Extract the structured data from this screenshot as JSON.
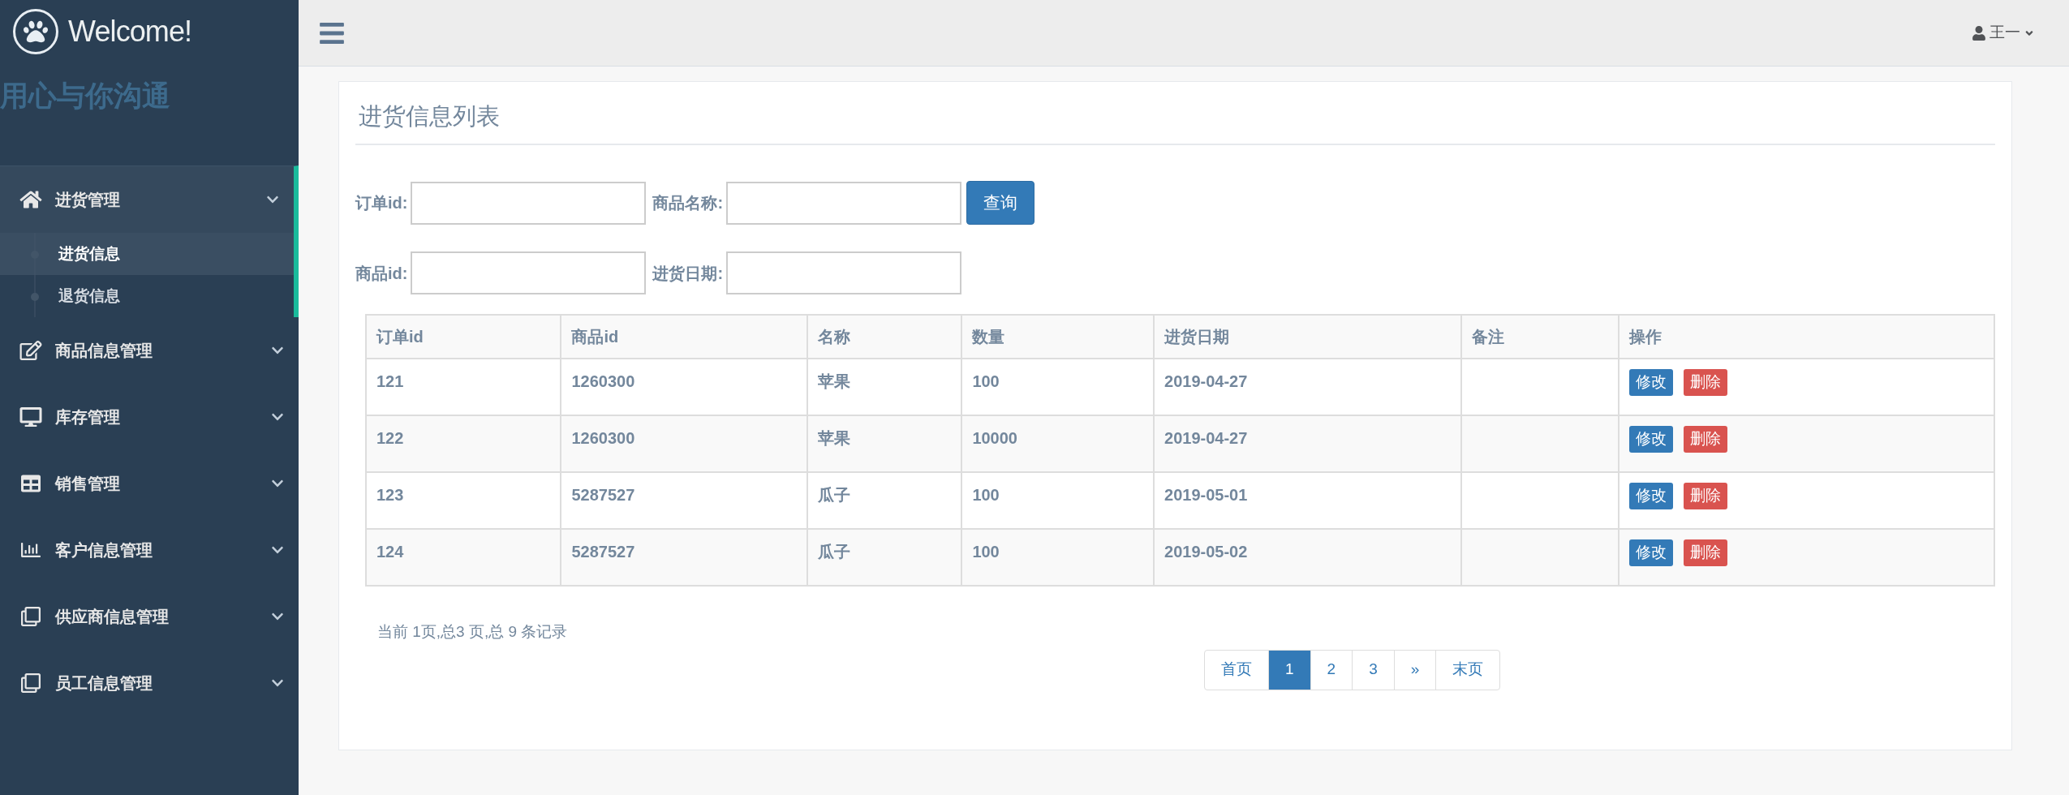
{
  "sidebar": {
    "brand": "Welcome!",
    "slogan": "用心与你沟通",
    "menu": [
      {
        "label": "进货管理",
        "expanded": true,
        "children": [
          {
            "label": "进货信息",
            "selected": true
          },
          {
            "label": "退货信息",
            "selected": false
          }
        ]
      },
      {
        "label": "商品信息管理",
        "expanded": false
      },
      {
        "label": "库存管理",
        "expanded": false
      },
      {
        "label": "销售管理",
        "expanded": false
      },
      {
        "label": "客户信息管理",
        "expanded": false
      },
      {
        "label": "供应商信息管理",
        "expanded": false
      },
      {
        "label": "员工信息管理",
        "expanded": false
      }
    ]
  },
  "topbar": {
    "user": "王一"
  },
  "panel": {
    "title": "进货信息列表",
    "form_rows": [
      {
        "fields": [
          {
            "label": "订单id:"
          },
          {
            "label": "商品名称:"
          }
        ]
      },
      {
        "fields": [
          {
            "label": "商品id:"
          },
          {
            "label": "进货日期:"
          }
        ]
      }
    ],
    "search_button": "查询",
    "table": {
      "columns": [
        "订单id",
        "商品id",
        "名称",
        "数量",
        "进货日期",
        "备注",
        "操作"
      ],
      "rows": [
        {
          "cells": [
            "121",
            "1260300",
            "苹果",
            "100",
            "2019-04-27"
          ],
          "actions": [
            "修改",
            "删除"
          ]
        },
        {
          "cells": [
            "122",
            "1260300",
            "苹果",
            "10000",
            "2019-04-27"
          ],
          "actions": [
            "修改",
            "删除"
          ]
        },
        {
          "cells": [
            "123",
            "5287527",
            "瓜子",
            "100",
            "2019-05-01"
          ],
          "actions": [
            "修改",
            "删除"
          ]
        },
        {
          "cells": [
            "124",
            "5287527",
            "瓜子",
            "100",
            "2019-05-02"
          ],
          "actions": [
            "修改",
            "删除"
          ]
        }
      ]
    },
    "summary": "当前 1页,总3 页,总 9 条记录",
    "pagination": [
      {
        "label": "首页",
        "selected": false
      },
      {
        "label": "1",
        "selected": true
      },
      {
        "label": "2",
        "selected": false
      },
      {
        "label": "3",
        "selected": false
      },
      {
        "label": "»",
        "selected": false
      },
      {
        "label": "末页",
        "selected": false
      }
    ]
  }
}
